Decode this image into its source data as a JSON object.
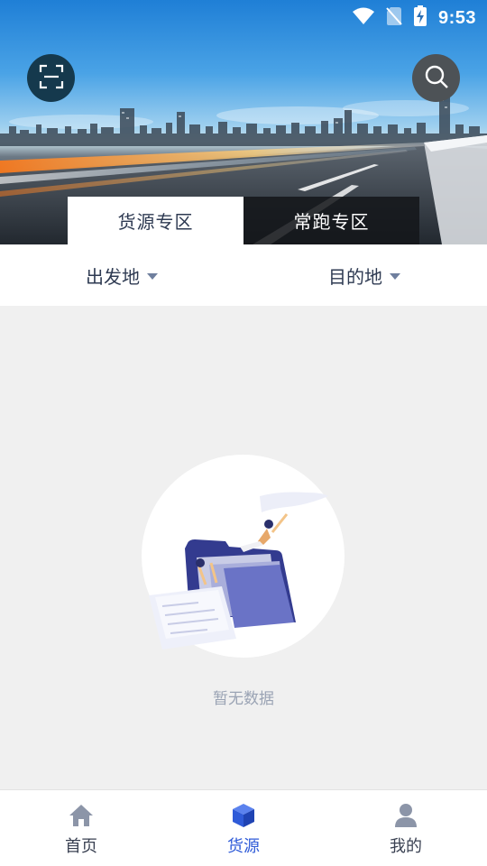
{
  "status_bar": {
    "time": "9:53",
    "icons": [
      "wifi-icon",
      "no-sim-icon",
      "battery-charging-icon"
    ]
  },
  "header": {
    "scan_icon": "scan-icon",
    "search_icon": "search-icon"
  },
  "tabs": [
    {
      "label": "货源专区",
      "active": true
    },
    {
      "label": "常跑专区",
      "active": false
    }
  ],
  "filters": {
    "origin_label": "出发地",
    "destination_label": "目的地"
  },
  "empty_state": {
    "message": "暂无数据"
  },
  "bottom_nav": [
    {
      "label": "首页",
      "icon": "home-icon",
      "active": false
    },
    {
      "label": "货源",
      "icon": "cube-icon",
      "active": true
    },
    {
      "label": "我的",
      "icon": "user-icon",
      "active": false
    }
  ],
  "colors": {
    "accent": "#2f5bd8",
    "text_primary": "#2e3a52",
    "empty_text": "#9aa3b4",
    "background": "#f0f0f0"
  }
}
